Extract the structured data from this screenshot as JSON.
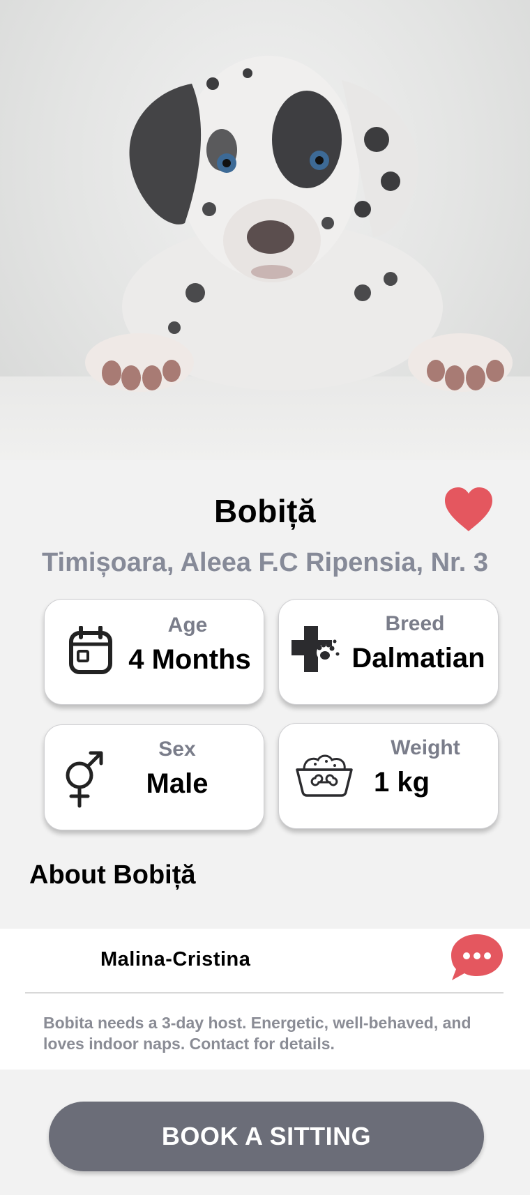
{
  "pet": {
    "name": "Bobiță",
    "address": "Timișoara, Aleea F.C Ripensia, Nr. 3"
  },
  "stats": {
    "age": {
      "label": "Age",
      "value": "4 Months",
      "icon": "calendar-icon"
    },
    "breed": {
      "label": "Breed",
      "value": "Dalmatian",
      "icon": "bone-paw-icon"
    },
    "sex": {
      "label": "Sex",
      "value": "Male",
      "icon": "gender-icon"
    },
    "weight": {
      "label": "Weight",
      "value": "1 kg",
      "icon": "food-bowl-icon"
    }
  },
  "about": {
    "title": "About Bobiță",
    "owner": "Malina-Cristina",
    "description": "Bobita needs a 3-day host. Energetic, well-behaved, and loves indoor naps. Contact for details."
  },
  "actions": {
    "book_label": "BOOK A SITTING"
  },
  "colors": {
    "heart": "#e4575f",
    "chat_bubble": "#e4575f",
    "button_bg": "#6b6d78",
    "address_text": "#868a98"
  }
}
